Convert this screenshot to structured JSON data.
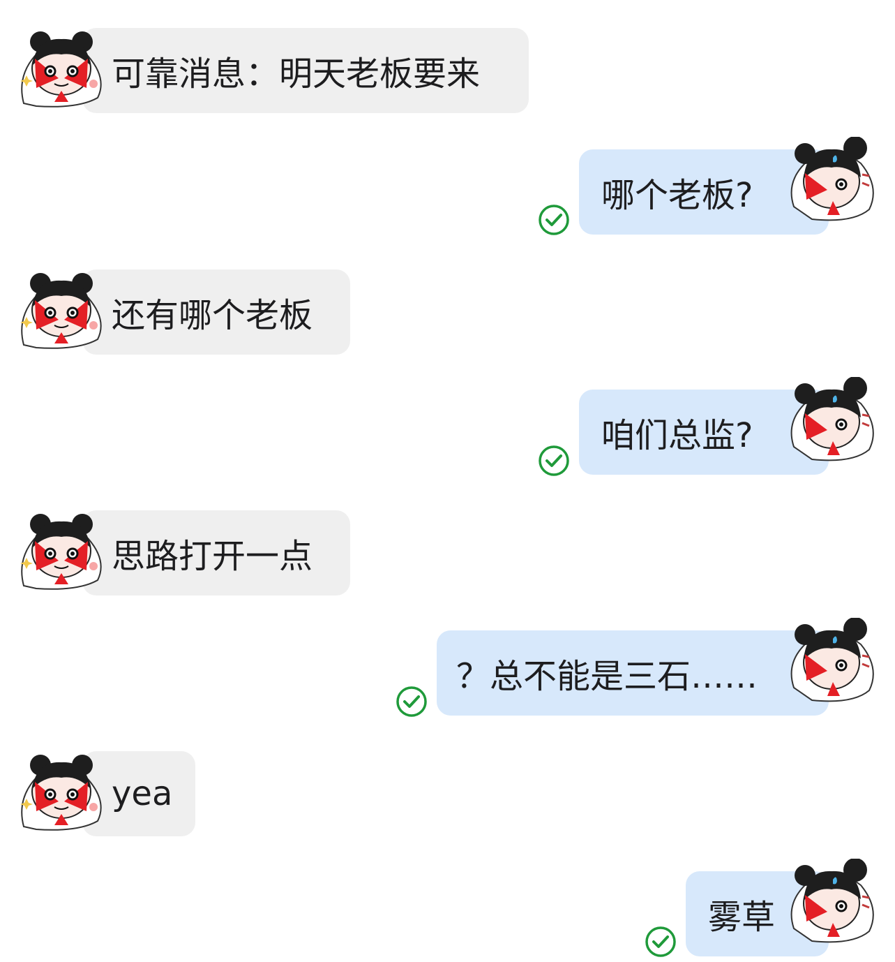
{
  "colors": {
    "incoming_bubble": "#efefef",
    "outgoing_bubble": "#d7e8fb",
    "check": "#1f9a3a",
    "text": "#1d1d1f"
  },
  "messages": [
    {
      "direction": "in",
      "text": "可靠消息：明天老板要来",
      "avatar": "girl-avatar-sparkle"
    },
    {
      "direction": "out",
      "text": "哪个老板?",
      "avatar": "girl-avatar-sweat",
      "status": "check-circle-icon"
    },
    {
      "direction": "in",
      "text": "还有哪个老板",
      "avatar": "girl-avatar-sparkle"
    },
    {
      "direction": "out",
      "text": "咱们总监?",
      "avatar": "girl-avatar-sweat",
      "status": "check-circle-icon"
    },
    {
      "direction": "in",
      "text": "思路打开一点",
      "avatar": "girl-avatar-sparkle"
    },
    {
      "direction": "out",
      "text": "？总不能是三石……",
      "avatar": "girl-avatar-sweat",
      "status": "check-circle-icon"
    },
    {
      "direction": "in",
      "text": "yea",
      "avatar": "girl-avatar-sparkle"
    },
    {
      "direction": "out",
      "text": "雾草",
      "avatar": "girl-avatar-sweat",
      "status": "check-circle-icon"
    }
  ]
}
